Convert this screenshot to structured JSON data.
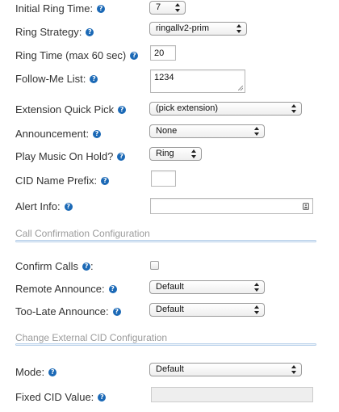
{
  "help_glyph": "?",
  "fields": {
    "initial_ring_time": {
      "label": "Initial Ring Time:",
      "value": "7"
    },
    "ring_strategy": {
      "label": "Ring Strategy:",
      "value": "ringallv2-prim"
    },
    "ring_time": {
      "label": "Ring Time (max 60 sec)",
      "value": "20"
    },
    "follow_me_list": {
      "label": "Follow-Me List:",
      "value": "1234"
    },
    "extension_quick_pick": {
      "label": "Extension Quick Pick",
      "value": "(pick extension)"
    },
    "announcement": {
      "label": "Announcement:",
      "value": "None"
    },
    "play_music_on_hold": {
      "label": "Play Music On Hold?",
      "value": "Ring"
    },
    "cid_name_prefix": {
      "label": "CID Name Prefix:",
      "value": ""
    },
    "alert_info": {
      "label": "Alert Info:",
      "value": ""
    }
  },
  "call_confirmation": {
    "title": "Call Confirmation Configuration",
    "confirm_calls": {
      "label": "Confirm Calls",
      "suffix": ":"
    },
    "remote_announce": {
      "label": "Remote Announce:",
      "value": "Default"
    },
    "too_late_announce": {
      "label": "Too-Late Announce:",
      "value": "Default"
    }
  },
  "external_cid": {
    "title": "Change External CID Configuration",
    "mode": {
      "label": "Mode:",
      "value": "Default"
    },
    "fixed_cid_value": {
      "label": "Fixed CID Value:",
      "value": ""
    }
  },
  "colors": {
    "help_icon": "#1b69b6",
    "section_title": "#9b9b9b",
    "section_rule": "#b8d0ea"
  },
  "icons": {
    "help": "help-icon",
    "contact": "contact-card-icon",
    "select_arrows": "updown-arrows-icon"
  }
}
